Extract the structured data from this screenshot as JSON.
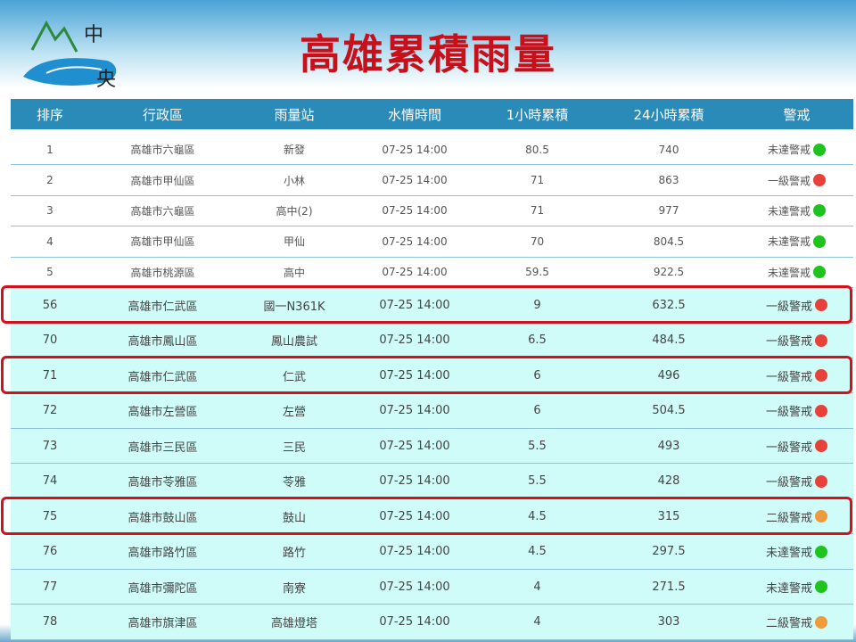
{
  "title": "高雄累積雨量",
  "logo": {
    "text": "中央社"
  },
  "columns": [
    "排序",
    "行政區",
    "雨量站",
    "水情時間",
    "1小時累積",
    "24小時累積",
    "警戒"
  ],
  "status_colors": {
    "green": "#1ec31e",
    "red": "#e8413a",
    "orange": "#ef9a3c"
  },
  "rows": [
    {
      "rank": "1",
      "district": "高雄市六龜區",
      "station": "新發",
      "time": "07-25 14:00",
      "h1": "80.5",
      "h24": "740",
      "alert": "未達警戒",
      "color": "green"
    },
    {
      "rank": "2",
      "district": "高雄市甲仙區",
      "station": "小林",
      "time": "07-25 14:00",
      "h1": "71",
      "h24": "863",
      "alert": "一級警戒",
      "color": "red"
    },
    {
      "rank": "3",
      "district": "高雄市六龜區",
      "station": "高中(2)",
      "time": "07-25 14:00",
      "h1": "71",
      "h24": "977",
      "alert": "未達警戒",
      "color": "green"
    },
    {
      "rank": "4",
      "district": "高雄市甲仙區",
      "station": "甲仙",
      "time": "07-25 14:00",
      "h1": "70",
      "h24": "804.5",
      "alert": "未達警戒",
      "color": "green"
    },
    {
      "rank": "5",
      "district": "高雄市桃源區",
      "station": "高中",
      "time": "07-25 14:00",
      "h1": "59.5",
      "h24": "922.5",
      "alert": "未達警戒",
      "color": "green"
    },
    {
      "rank": "56",
      "district": "高雄市仁武區",
      "station": "國一N361K",
      "time": "07-25 14:00",
      "h1": "9",
      "h24": "632.5",
      "alert": "一級警戒",
      "color": "red"
    },
    {
      "rank": "70",
      "district": "高雄市鳳山區",
      "station": "鳳山農試",
      "time": "07-25 14:00",
      "h1": "6.5",
      "h24": "484.5",
      "alert": "一級警戒",
      "color": "red"
    },
    {
      "rank": "71",
      "district": "高雄市仁武區",
      "station": "仁武",
      "time": "07-25 14:00",
      "h1": "6",
      "h24": "496",
      "alert": "一級警戒",
      "color": "red"
    },
    {
      "rank": "72",
      "district": "高雄市左營區",
      "station": "左營",
      "time": "07-25 14:00",
      "h1": "6",
      "h24": "504.5",
      "alert": "一級警戒",
      "color": "red"
    },
    {
      "rank": "73",
      "district": "高雄市三民區",
      "station": "三民",
      "time": "07-25 14:00",
      "h1": "5.5",
      "h24": "493",
      "alert": "一級警戒",
      "color": "red"
    },
    {
      "rank": "74",
      "district": "高雄市苓雅區",
      "station": "苓雅",
      "time": "07-25 14:00",
      "h1": "5.5",
      "h24": "428",
      "alert": "一級警戒",
      "color": "red"
    },
    {
      "rank": "75",
      "district": "高雄市鼓山區",
      "station": "鼓山",
      "time": "07-25 14:00",
      "h1": "4.5",
      "h24": "315",
      "alert": "二級警戒",
      "color": "orange"
    },
    {
      "rank": "76",
      "district": "高雄市路竹區",
      "station": "路竹",
      "time": "07-25 14:00",
      "h1": "4.5",
      "h24": "297.5",
      "alert": "未達警戒",
      "color": "green"
    },
    {
      "rank": "77",
      "district": "高雄市彌陀區",
      "station": "南寮",
      "time": "07-25 14:00",
      "h1": "4",
      "h24": "271.5",
      "alert": "未達警戒",
      "color": "green"
    },
    {
      "rank": "78",
      "district": "高雄市旗津區",
      "station": "高雄燈塔",
      "time": "07-25 14:00",
      "h1": "4",
      "h24": "303",
      "alert": "二級警戒",
      "color": "orange"
    }
  ],
  "highlighted_ranks": [
    "56",
    "71",
    "75"
  ]
}
